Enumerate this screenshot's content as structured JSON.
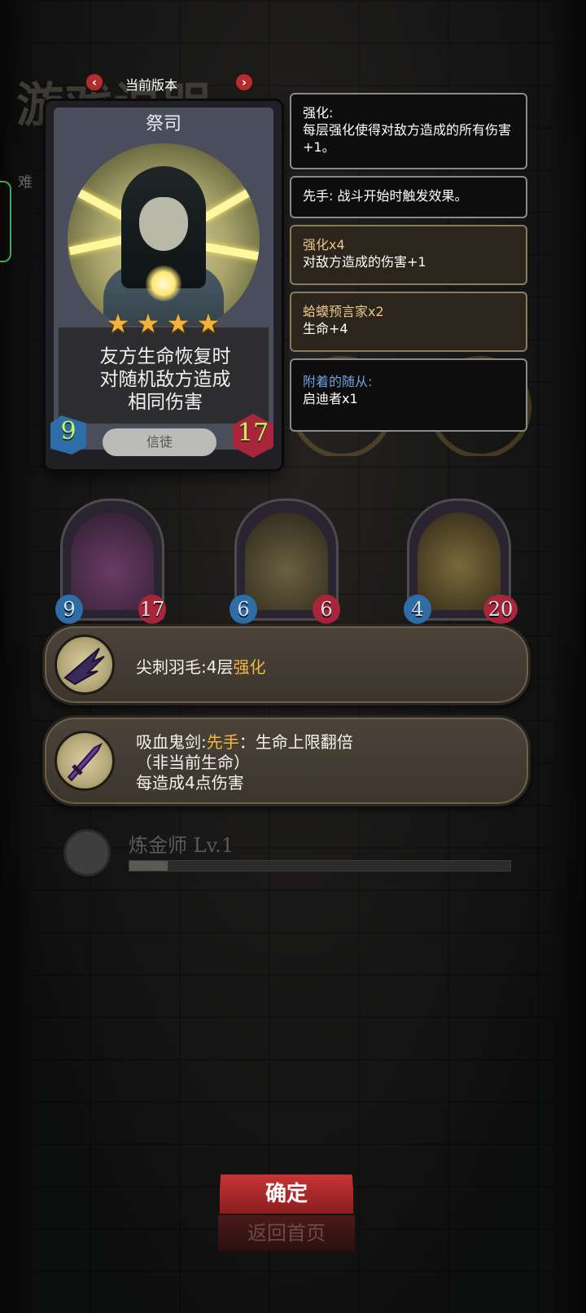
{
  "background": {
    "title": "游戏说明",
    "side_text": "难"
  },
  "version_selector": {
    "prev_label": "‹",
    "next_label": "›",
    "label": "当前版本"
  },
  "card": {
    "name": "祭司",
    "stars": 4,
    "description_lines": [
      "友方生命恢复时",
      "对随机敌方造成",
      "相同伤害"
    ],
    "cost": "9",
    "health": "17",
    "tribe": "信徒"
  },
  "info_boxes": {
    "enhance": {
      "title": "强化:",
      "body": "每层强化使得对敌方造成的所有伤害+1。"
    },
    "first_strike": {
      "title": "先手:",
      "body": "战斗开始时触发效果。"
    },
    "enhance_x4": {
      "title": "强化x4",
      "body": "对敌方造成的伤害+1"
    },
    "toad_prophet": {
      "title": "蛤蟆预言家x2",
      "body": "生命+4"
    },
    "attached": {
      "title": "附着的随从:",
      "body": "启迪者x1"
    }
  },
  "units": [
    {
      "attack": "9",
      "health": "17"
    },
    {
      "attack": "6",
      "health": "6"
    },
    {
      "attack": "4",
      "health": "20"
    }
  ],
  "relics": [
    {
      "icon": "spike-feather-icon",
      "name": "尖刺羽毛",
      "sep": ":",
      "text": "4层",
      "highlight": "强化"
    },
    {
      "icon": "vampire-sword-icon",
      "name": "吸血鬼剑",
      "sep": ":",
      "highlight": "先手",
      "line1_rest": "：生命上限翻倍",
      "line2": "（非当前生命）",
      "line3": "每造成4点伤害"
    }
  ],
  "alchemist": {
    "name": "炼金师 Lv.1",
    "progress": 0.1
  },
  "buttons": {
    "confirm": "确定",
    "home": "返回首页"
  },
  "colors": {
    "accent_gold": "#f0b840",
    "button_red": "#c83434",
    "attack_green": "#c6f36a"
  }
}
